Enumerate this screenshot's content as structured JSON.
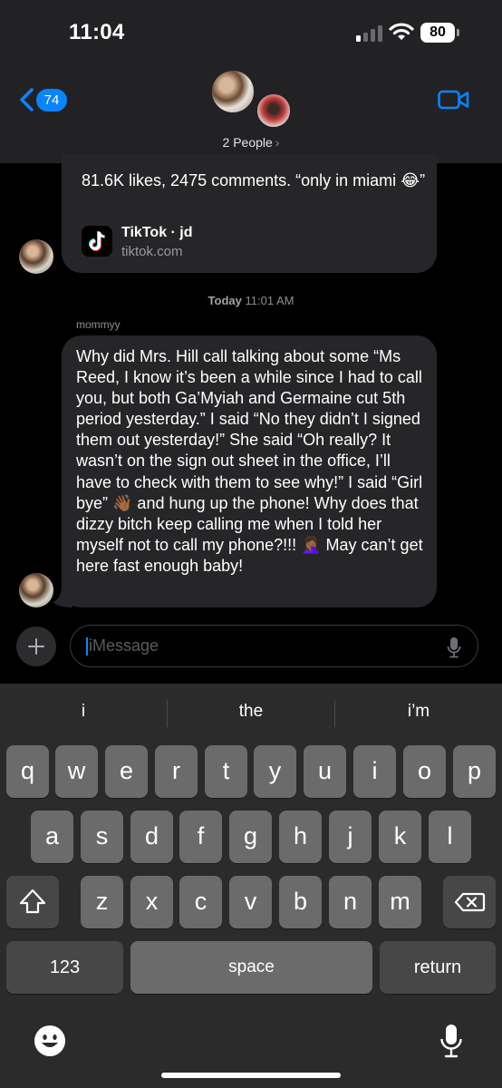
{
  "status_bar": {
    "time": "11:04",
    "battery": "80"
  },
  "nav": {
    "back_count": "74",
    "people_label": "2 People",
    "people_chevron": "›"
  },
  "link_preview": {
    "caption": "81.6K likes, 2475 comments. “only in miami 😂”",
    "site_name": "TikTok · jd",
    "domain": "tiktok.com"
  },
  "timestamp": {
    "day": "Today",
    "time": "11:01 AM"
  },
  "message": {
    "sender": "mommyy",
    "text": "Why did Mrs. Hill call talking about some “Ms Reed, I know it’s been a while since I had to call you, but both Ga’Myiah and Germaine cut 5th period yesterday.” I said “No they didn’t I signed them out yesterday!” She said “Oh really? It wasn’t on the sign out sheet in the office, I’ll have to check with them to see why!” I said “Girl bye” 👋🏾 and hung up the phone! Why does that dizzy bitch keep calling me when I told her myself not to call my phone?!!! 🤦🏾‍♀️ May can’t get here fast enough baby!"
  },
  "compose": {
    "placeholder": "iMessage"
  },
  "keyboard": {
    "suggestions": [
      "i",
      "the",
      "i’m"
    ],
    "row1": [
      "q",
      "w",
      "e",
      "r",
      "t",
      "y",
      "u",
      "i",
      "o",
      "p"
    ],
    "row2": [
      "a",
      "s",
      "d",
      "f",
      "g",
      "h",
      "j",
      "k",
      "l"
    ],
    "row3": [
      "z",
      "x",
      "c",
      "v",
      "b",
      "n",
      "m"
    ],
    "numbers_label": "123",
    "space_label": "space",
    "return_label": "return"
  },
  "colors": {
    "accent": "#0a84ff",
    "bubble": "#262628",
    "header": "#222224",
    "keyboard": "#2b2b2b"
  },
  "icons": [
    "signal-icon",
    "wifi-icon",
    "battery-icon",
    "back-chevron-icon",
    "video-icon",
    "tiktok-icon",
    "plus-icon",
    "mic-icon",
    "emoji-icon",
    "shift-icon",
    "delete-icon"
  ]
}
